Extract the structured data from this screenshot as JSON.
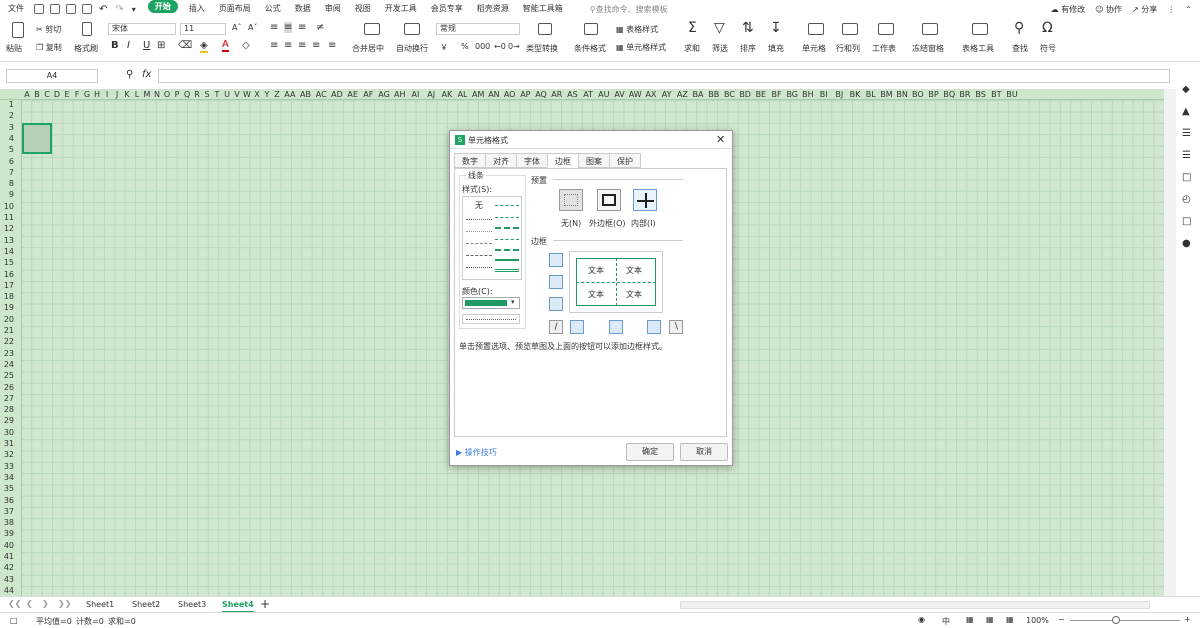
{
  "menubar": {
    "file": "文件",
    "items": [
      "开始",
      "插入",
      "页面布局",
      "公式",
      "数据",
      "审阅",
      "视图",
      "开发工具",
      "会员专享",
      "稻壳资源",
      "智能工具箱"
    ],
    "active_index": 0,
    "search_placeholder": "查找命令、搜索模板",
    "right": [
      "有修改",
      "协作",
      "分享"
    ]
  },
  "ribbon": {
    "paste": "粘贴",
    "cut": "剪切",
    "copy": "复制",
    "format_painter": "格式刷",
    "font_name": "宋体",
    "font_size": "11",
    "bold": "B",
    "italic": "I",
    "underline": "U",
    "merge_center": "合并居中",
    "wrap_text": "自动换行",
    "number_format": "常规",
    "type_convert": "类型转换",
    "cond_format": "条件格式",
    "table_style": "表格样式",
    "cell_style": "单元格样式",
    "sum": "求和",
    "filter": "筛选",
    "sort": "排序",
    "fill": "填充",
    "cell": "单元格",
    "row_col": "行和列",
    "sheet": "工作表",
    "freeze": "冻结窗格",
    "table_tools": "表格工具",
    "find": "查找",
    "symbol": "符号",
    "currency": "￥",
    "percent": "%",
    "thousands": "000"
  },
  "formula_bar": {
    "name_box": "A4",
    "fx": "fx",
    "value": ""
  },
  "grid": {
    "columns": [
      "A",
      "B",
      "C",
      "D",
      "E",
      "F",
      "G",
      "H",
      "I",
      "J",
      "K",
      "L",
      "M",
      "N",
      "O",
      "P",
      "Q",
      "R",
      "S",
      "T",
      "U",
      "V",
      "W",
      "X",
      "Y",
      "Z",
      "AA",
      "AB",
      "AC",
      "AD",
      "AE",
      "AF",
      "AG",
      "AH",
      "AI",
      "AJ",
      "AK",
      "AL",
      "AM",
      "AN",
      "AO",
      "AP",
      "AQ",
      "AR",
      "AS",
      "AT",
      "AU",
      "AV",
      "AW",
      "AX",
      "AY",
      "AZ",
      "BA",
      "BB",
      "BC",
      "BD",
      "BE",
      "BF",
      "BG",
      "BH",
      "BI",
      "BJ",
      "BK",
      "BL",
      "BM",
      "BN",
      "BO",
      "BP",
      "BQ",
      "BR",
      "BS",
      "BT",
      "BU"
    ],
    "rows": [
      "1",
      "2",
      "3",
      "4",
      "5",
      "6",
      "7",
      "8",
      "9",
      "10",
      "11",
      "12",
      "13",
      "14",
      "15",
      "16",
      "17",
      "18",
      "19",
      "20",
      "21",
      "22",
      "23",
      "24",
      "25",
      "26",
      "27",
      "28",
      "29",
      "30",
      "31",
      "32",
      "33",
      "34",
      "35",
      "36",
      "37",
      "38",
      "39",
      "40",
      "41",
      "42",
      "43",
      "44",
      "45"
    ]
  },
  "sheets": {
    "tabs": [
      "Sheet1",
      "Sheet2",
      "Sheet3",
      "Sheet4"
    ],
    "active_index": 3
  },
  "status": {
    "avg": "平均值=0",
    "count": "计数=0",
    "sum": "求和=0",
    "zoom": "100%",
    "view_label": "中"
  },
  "dialog": {
    "title": "单元格格式",
    "tabs": [
      "数字",
      "对齐",
      "字体",
      "边框",
      "图案",
      "保护"
    ],
    "active_tab_index": 3,
    "line_group": "线条",
    "style_label": "样式(S):",
    "style_none": "无",
    "color_label": "颜色(C):",
    "color_value": "#1e9a62",
    "preset_group": "预置",
    "preset_none": "无(N)",
    "preset_outline": "外边框(O)",
    "preset_inside": "内部(I)",
    "border_group": "边框",
    "preview_text": [
      "文本",
      "文本",
      "文本",
      "文本"
    ],
    "hint": "单击预置选项、预览草图及上面的按钮可以添加边框样式。",
    "tips": "操作技巧",
    "ok": "确定",
    "cancel": "取消"
  }
}
